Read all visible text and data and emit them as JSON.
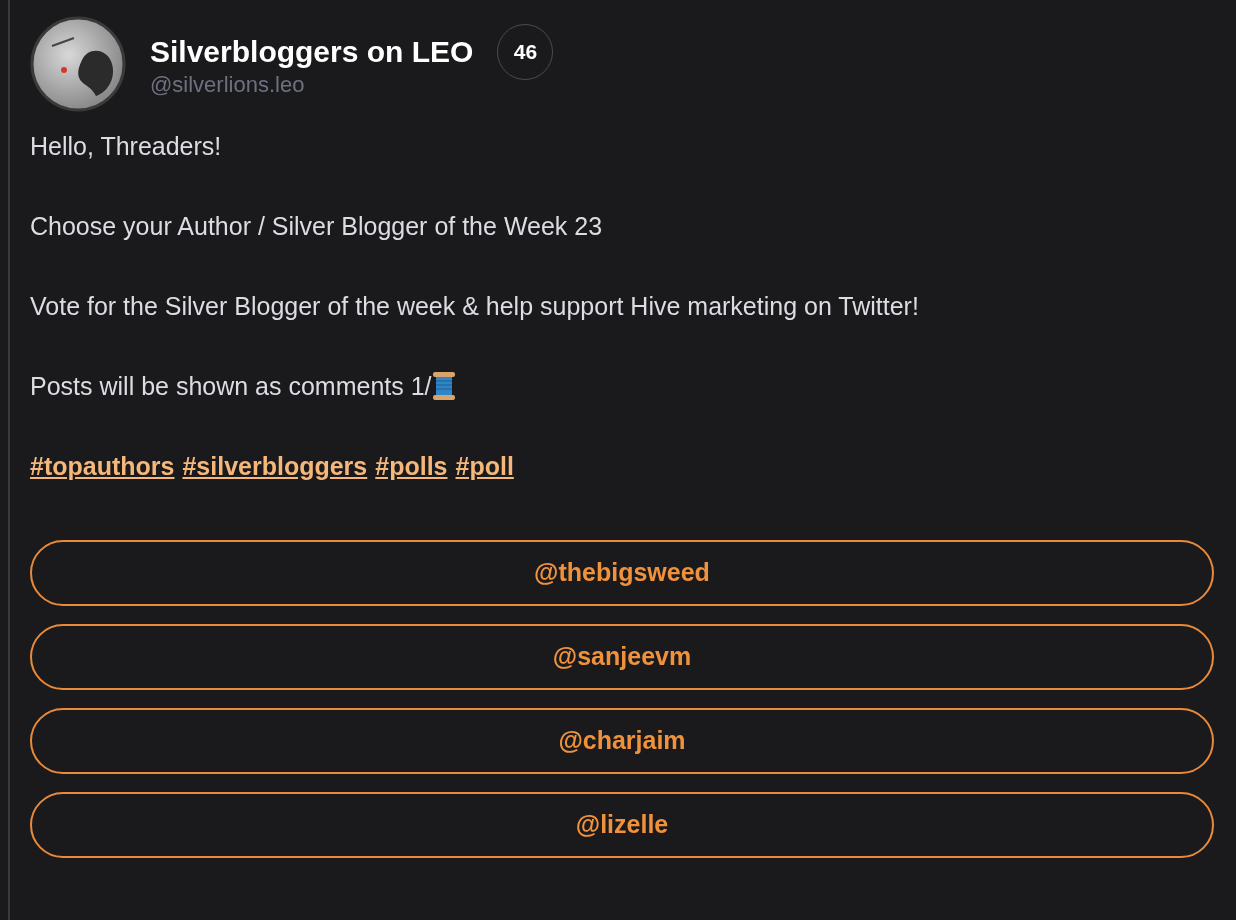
{
  "author": {
    "name": "Silverbloggers on LEO",
    "handle": "@silverlions.leo",
    "badge": "46"
  },
  "paragraphs": [
    {
      "text": "Hello, Threaders!"
    },
    {
      "text": "Choose your Author / Silver Blogger of the Week 23"
    },
    {
      "text": "Vote for the Silver Blogger of the week & help support Hive marketing on Twitter!"
    },
    {
      "text": "Posts will be shown as comments 1/",
      "kind": "thread"
    }
  ],
  "hashtags": [
    "#topauthors",
    "#silverbloggers",
    "#polls",
    "#poll"
  ],
  "poll_options": [
    "@thebigsweed",
    "@sanjeevm",
    "@charjaim",
    "@lizelle"
  ]
}
